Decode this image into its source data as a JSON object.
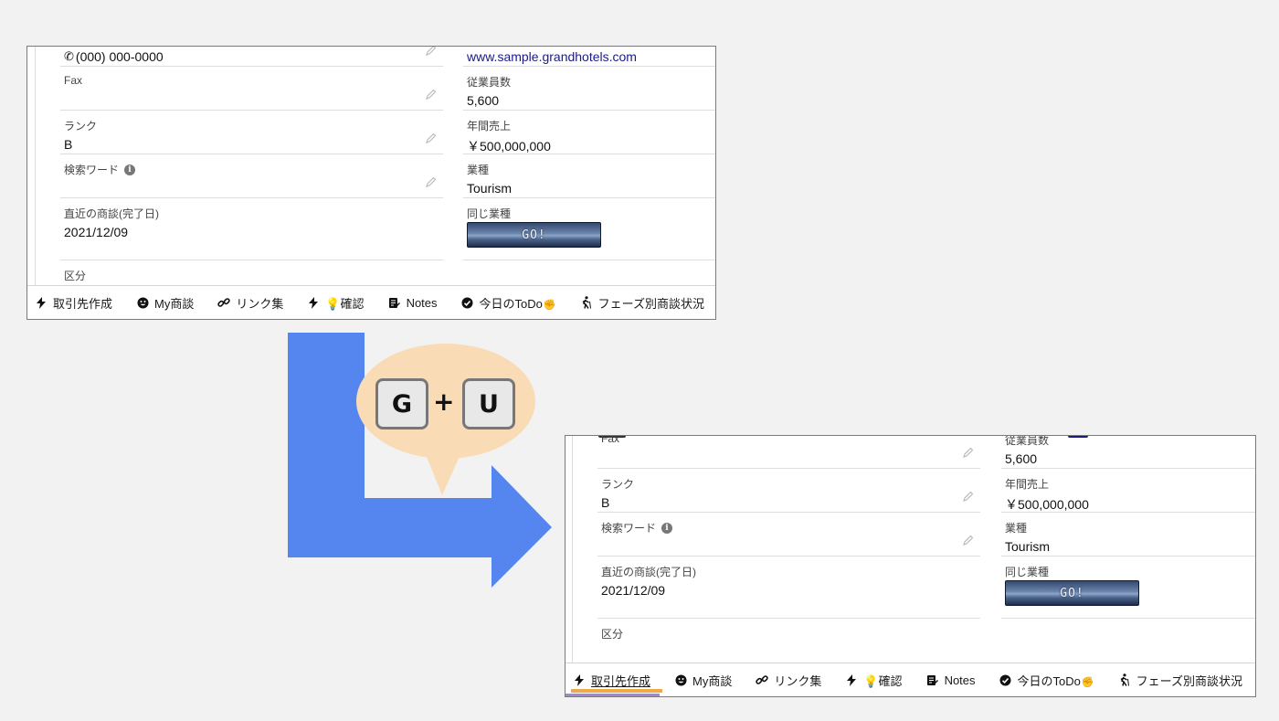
{
  "record": {
    "phone": "(000) 000-0000",
    "website": "www.sample.grandhotels.com",
    "fax_label": "Fax",
    "fax_value": "",
    "employees_label": "従業員数",
    "employees_value": "5,600",
    "rank_label": "ランク",
    "rank_value": "B",
    "revenue_label": "年間売上",
    "revenue_value": "￥500,000,000",
    "search_label": "検索ワード",
    "industry_label": "業種",
    "industry_value": "Tourism",
    "last_deal_label": "直近の商談(完了日)",
    "last_deal_value": "2021/12/09",
    "same_industry_label": "同じ業種",
    "go_label": "GO!",
    "category_label": "区分"
  },
  "utility_bar": {
    "items": [
      {
        "label": "取引先作成",
        "icon": "lightning-icon"
      },
      {
        "label": "My商談",
        "icon": "smiley-icon"
      },
      {
        "label": "リンク集",
        "icon": "link-icon"
      },
      {
        "label": "💡確認",
        "icon": "lightning-icon"
      },
      {
        "label": "Notes",
        "icon": "notes-icon"
      },
      {
        "label": "今日のToDo",
        "emoji": "✊",
        "icon": "check-circle-icon"
      },
      {
        "label": "フェーズ別商談状況",
        "icon": "hiker-icon"
      }
    ]
  },
  "shortcut": {
    "key1": "G",
    "plus": "+",
    "key2": "U"
  },
  "colors": {
    "arrow": "#5585ee",
    "bubble": "#f9dcb6",
    "active_tab_underline": "#f0a94a",
    "link": "#1a1a8c"
  }
}
